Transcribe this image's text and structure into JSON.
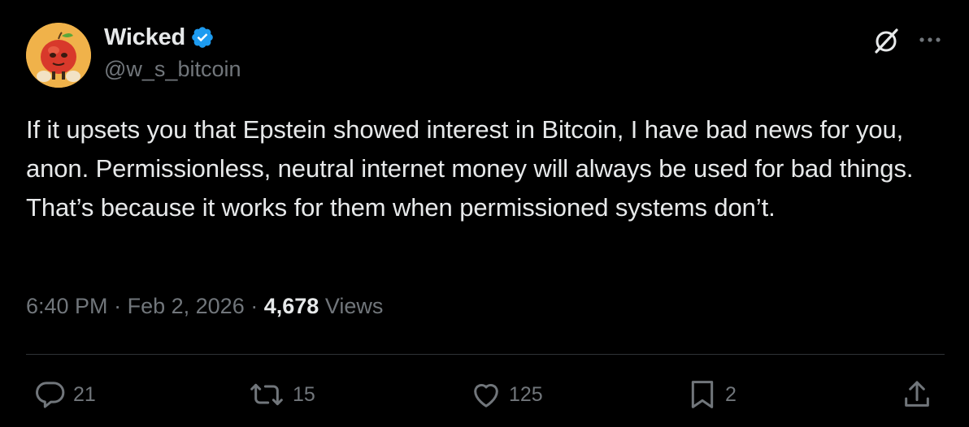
{
  "author": {
    "display_name": "Wicked",
    "handle": "@w_s_bitcoin",
    "verified": true,
    "avatar_description": "cartoon apple character avatar"
  },
  "icons": {
    "verified": "verified-badge-icon",
    "grok": "grok-icon",
    "more": "more-options-icon",
    "reply": "reply-icon",
    "repost": "repost-icon",
    "like": "heart-icon",
    "bookmark": "bookmark-icon",
    "share": "share-icon"
  },
  "tweet": {
    "text": "If it upsets you that Epstein showed interest in Bitcoin, I have bad news for you, anon. Permissionless, neutral internet money will always be used for bad things. That’s because it works for them when permissioned systems don’t.",
    "time": "6:40 PM",
    "separator": "·",
    "date": "Feb 2, 2026",
    "views_count": "4,678",
    "views_label": "Views"
  },
  "actions": {
    "replies": "21",
    "reposts": "15",
    "likes": "125",
    "bookmarks": "2"
  },
  "colors": {
    "background": "#000000",
    "primary_text": "#e7e9ea",
    "secondary_text": "#71767b",
    "verified_blue": "#1d9bf0",
    "divider": "#2f3336",
    "avatar_bg": "#f0b24a"
  }
}
